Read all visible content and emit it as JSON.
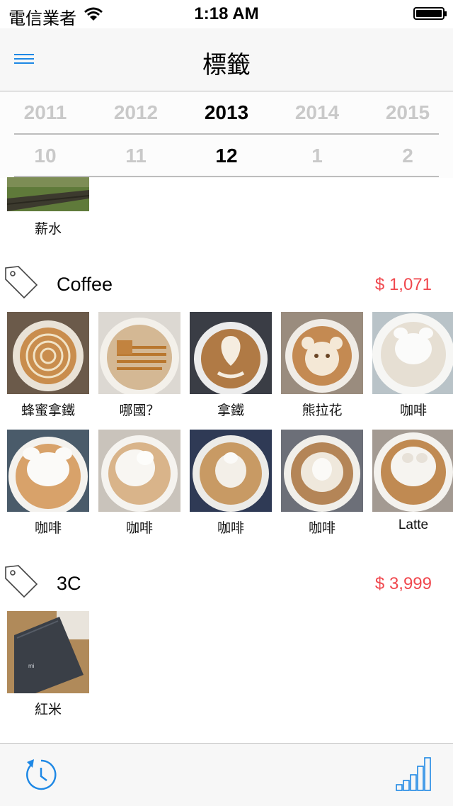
{
  "status_bar": {
    "carrier": "電信業者",
    "time": "1:18 AM"
  },
  "nav": {
    "title": "標籤"
  },
  "year_picker": {
    "items": [
      "2011",
      "2012",
      "2013",
      "2014",
      "2015"
    ],
    "selected": "2013"
  },
  "month_picker": {
    "items": [
      "10",
      "11",
      "12",
      "1",
      "2"
    ],
    "selected": "12"
  },
  "groups": [
    {
      "items": [
        {
          "label": "薪水",
          "image": "grass-fence-photo"
        }
      ]
    },
    {
      "name": "Coffee",
      "amount": "$ 1,071",
      "items": [
        {
          "label": "蜂蜜拿鐵",
          "image": "honey-latte-photo"
        },
        {
          "label": "哪國？",
          "image": "flag-latte-art-photo"
        },
        {
          "label": "拿鐵",
          "image": "heart-latte-art-photo"
        },
        {
          "label": "熊拉花",
          "image": "bear-latte-art-photo"
        },
        {
          "label": "咖啡",
          "image": "foam-bear-photo"
        },
        {
          "label": "咖啡",
          "image": "foam-bear-photo"
        },
        {
          "label": "咖啡",
          "image": "foam-bear-photo"
        },
        {
          "label": "咖啡",
          "image": "foam-bear-photo"
        },
        {
          "label": "咖啡",
          "image": "foam-bear-photo"
        },
        {
          "label": "Latte",
          "image": "foam-bear-photo"
        }
      ]
    },
    {
      "name": "3C",
      "amount": "$ 3,999",
      "items": [
        {
          "label": "紅米",
          "image": "smartphone-photo"
        }
      ]
    }
  ],
  "tab_bar": {
    "left_icon": "history-icon",
    "right_icon": "bar-chart-icon"
  },
  "colors": {
    "accent": "#1e88e5",
    "amount": "#f0484e"
  }
}
